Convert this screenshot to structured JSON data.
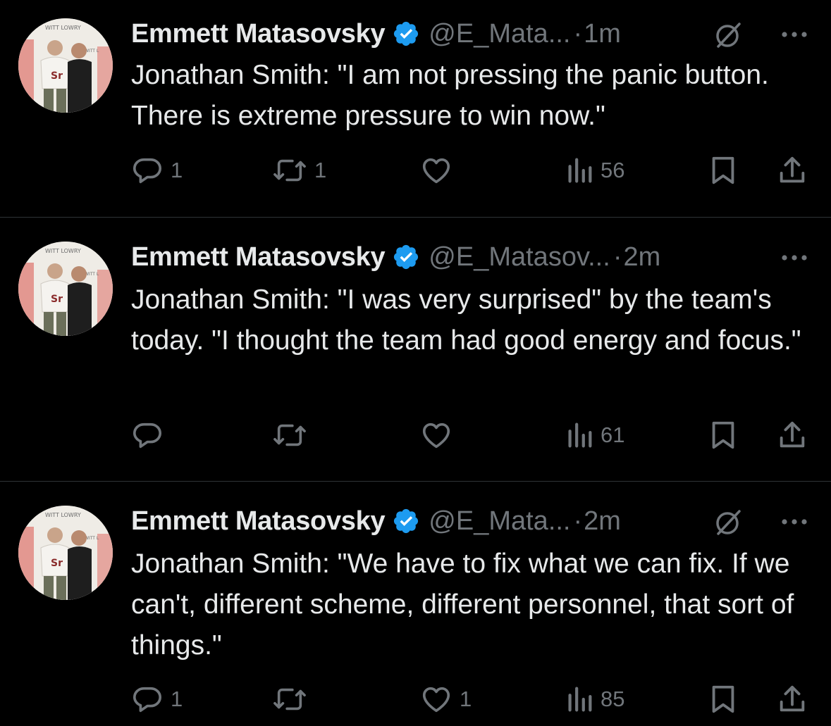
{
  "colors": {
    "background": "#000000",
    "text": "#e7e9ea",
    "secondary": "#71767b",
    "verified": "#1d9bf0",
    "divider": "#2f3336"
  },
  "tweets": [
    {
      "author": {
        "name": "Emmett Matasovsky",
        "handle": "@E_Mata...",
        "verified": true
      },
      "time": "1m",
      "separator": "·",
      "text": "Jonathan Smith: \"I am not pressing the panic button. There is extreme pressure to win now.\"",
      "has_grok_icon": true,
      "stats": {
        "replies": "1",
        "reposts": "1",
        "likes": "",
        "views": "56"
      }
    },
    {
      "author": {
        "name": "Emmett Matasovsky",
        "handle": "@E_Matasov...",
        "verified": true
      },
      "time": "2m",
      "separator": "·",
      "text": "Jonathan Smith: \"I was very surprised\" by the team's today. \"I thought the team had good energy and focus.\"",
      "has_grok_icon": false,
      "stats": {
        "replies": "",
        "reposts": "",
        "likes": "",
        "views": "61"
      }
    },
    {
      "author": {
        "name": "Emmett Matasovsky",
        "handle": "@E_Mata...",
        "verified": true
      },
      "time": "2m",
      "separator": "·",
      "text": "Jonathan Smith: \"We have to fix what we can fix. If we can't, different scheme, different personnel, that sort of things.\"",
      "has_grok_icon": true,
      "stats": {
        "replies": "1",
        "reposts": "",
        "likes": "1",
        "views": "85"
      }
    }
  ],
  "icons": {
    "reply": "reply-icon",
    "repost": "repost-icon",
    "like": "heart-icon",
    "views": "views-icon",
    "bookmark": "bookmark-icon",
    "share": "share-icon",
    "verified": "verified-badge-icon",
    "grok": "grok-icon",
    "more": "more-icon"
  }
}
